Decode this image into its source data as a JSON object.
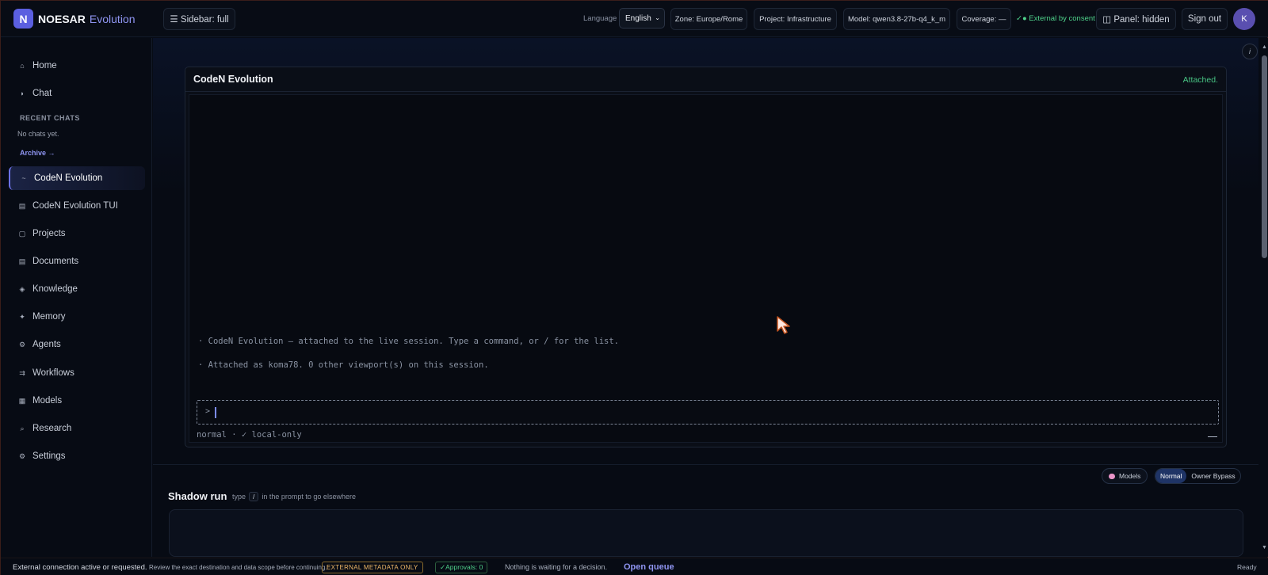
{
  "brand": {
    "logo_letter": "N",
    "name": "NOESAR",
    "sub": "Evolution"
  },
  "topbar": {
    "sidebar_toggle": "☰  Sidebar: full",
    "language_label": "Language",
    "language_value": "English",
    "zone": "Zone: Europe/Rome",
    "project": "Project: Infrastructure",
    "model": "Model: qwen3.8-27b-q4_k_m",
    "coverage": "Coverage: —",
    "consent": "✓● External by consent",
    "panel": "◫  Panel: hidden",
    "signout": "Sign out",
    "avatar": "K"
  },
  "sidebar": {
    "items": [
      {
        "icon": "⌂",
        "label": "Home"
      },
      {
        "icon": "◗",
        "label": "Chat"
      },
      {
        "icon": "~",
        "label": "CodeN Evolution"
      },
      {
        "icon": "▤",
        "label": "CodeN Evolution TUI"
      },
      {
        "icon": "▢",
        "label": "Projects"
      },
      {
        "icon": "▤",
        "label": "Documents"
      },
      {
        "icon": "◈",
        "label": "Knowledge"
      },
      {
        "icon": "✦",
        "label": "Memory"
      },
      {
        "icon": "⚙",
        "label": "Agents"
      },
      {
        "icon": "⇉",
        "label": "Workflows"
      },
      {
        "icon": "▦",
        "label": "Models"
      },
      {
        "icon": "⌕",
        "label": "Research"
      },
      {
        "icon": "⚙",
        "label": "Settings"
      }
    ],
    "recent_heading": "RECENT CHATS",
    "recent_empty": "No chats yet.",
    "archive": "Archive →"
  },
  "panel": {
    "title": "CodeN Evolution",
    "status": "Attached.",
    "lines": [
      "· CodeN Evolution — attached to the live session. Type a command, or / for the list.",
      "· Attached as koma78. 0 other viewport(s) on this session."
    ],
    "prompt": ">",
    "mode": "normal · ✓ local-only"
  },
  "info_button": "i",
  "shadow": {
    "models_pill": "Models",
    "mode_normal": "Normal",
    "mode_bypass": "Owner Bypass",
    "title": "Shadow run",
    "hint_pre": "type",
    "hint_key": "/",
    "hint_post": "in the prompt to go elsewhere"
  },
  "statusbar": {
    "main": "External connection active or requested.",
    "sub": "Review the exact destination and data scope before continuing.",
    "badge": "EXTERNAL METADATA ONLY",
    "approvals": "✓Approvals: 0",
    "waiting": "Nothing is waiting for a decision.",
    "queue": "Open queue",
    "ready": "Ready"
  },
  "colors": {
    "accent": "#6c72e8",
    "success": "#48c584",
    "warning": "#f0b969",
    "background": "#070b14"
  }
}
